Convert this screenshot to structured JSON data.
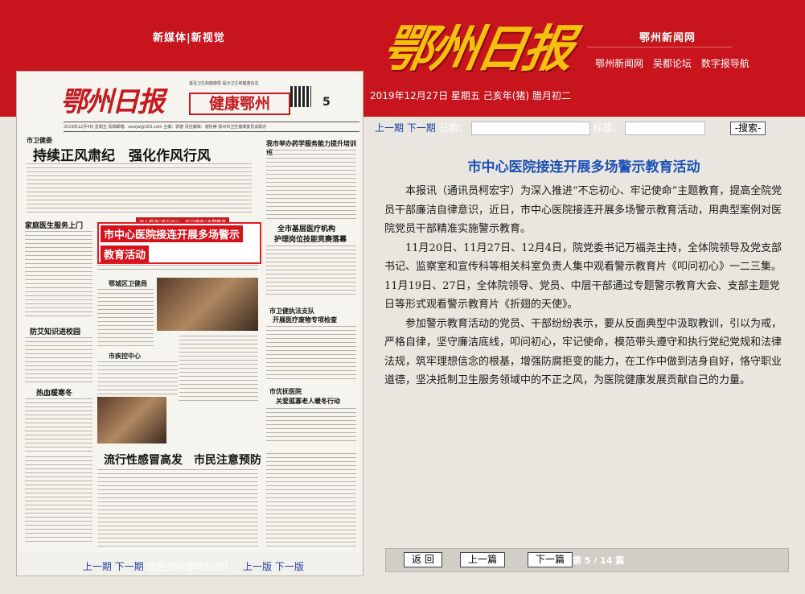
{
  "header": {
    "left_links": "新媒体|新视觉",
    "logo_text": "鄂州日报",
    "right_title": "鄂州新闻网",
    "right_links": [
      "鄂州新闻网",
      "吴都论坛",
      "数字报导航"
    ],
    "date_line": "2019年12月27日 星期五 己亥年(猪) 腊月初二"
  },
  "paper_page": {
    "logo": "鄂州日报",
    "top_note": "首及卫生和健康局 提示卫生和健康信息",
    "section_banner": "健康鄂州",
    "page_number": "5",
    "meta_line": "2019年12月4日    星期五    投稿邮箱：ezwjw@163.com    主编：郭德    责任编辑：谢怡蒂    鄂州市卫生健康委员会联办",
    "column_label_1": "市卫健委",
    "headline_main": "持续正风肃纪　强化作风行风",
    "headline_right": "我市举办药学服务能力提升培训班",
    "sub_1": "家庭医生服务上门",
    "sub_2": "防艾知识进校园",
    "sub_3": "热血暖寒冬",
    "red_strip": "深入推进“不忘初心、牢记使命”主题教育",
    "highlight_title_1": "市中心医院接连开展多场警示",
    "highlight_title_2": "教育活动",
    "mid_right_head_1": "全市基层医疗机构",
    "mid_right_head_2": "护理岗位技能竞赛落幕",
    "mid_col_1": "鄂城区卫健局",
    "mid_col_2": "市疾控中心",
    "right_sec_1": "市卫健执法支队",
    "right_head_1": "开展医疗废物专项检查",
    "right_sec_2": "市优抚医院",
    "right_head_2": "关爱孤寡老人暖冬行动",
    "bottom_headline": "流行性感冒高发　市民注意预防"
  },
  "left_footer": {
    "prev_issue": "上一期",
    "next_issue": "下一期",
    "welcome": "欢迎访问鄂州日报！",
    "prev_page": "上一版",
    "next_page": "下一版"
  },
  "nav": {
    "prev_issue": "上一期",
    "next_issue": "下一期",
    "date_label": "日期：",
    "title_label": "标题：",
    "search_button": "-搜索-"
  },
  "article": {
    "title": "市中心医院接连开展多场警示教育活动",
    "paragraphs": [
      "本报讯（通讯员柯宏宇）为深入推进“不忘初心、牢记使命”主题教育，提高全院党员干部廉洁自律意识，近日，市中心医院接连开展多场警示教育活动，用典型案例对医院党员干部精准实施警示教育。",
      "11月20日、11月27日、12月4日，院党委书记万福尧主持，全体院领导及党支部书记、监察室和宣传科等相关科室负责人集中观看警示教育片《叩问初心》一二三集。11月19日、27日，全体院领导、党员、中层干部通过专题警示教育大会、支部主题党日等形式观看警示教育片《折翅的天使》。",
      "参加警示教育活动的党员、干部纷纷表示，要从反面典型中汲取教训，引以为戒，严格自律，坚守廉洁底线，叩问初心，牢记使命，模范带头遵守和执行党纪党规和法律法规，筑牢理想信念的根基，增强防腐拒变的能力，在工作中做到洁身自好，恪守职业道德，坚决抵制卫生服务领域中的不正之风，为医院健康发展贡献自己的力量。"
    ]
  },
  "bottom_nav": {
    "back": "返 回",
    "prev": "上一篇",
    "next": "下一篇",
    "page_info": "第 5 / 14 篇"
  },
  "colors": {
    "header_red": "#c8141c",
    "logo_gold": "#f5c10e",
    "link_blue": "#1e3ea6",
    "title_blue": "#1d51b8"
  }
}
